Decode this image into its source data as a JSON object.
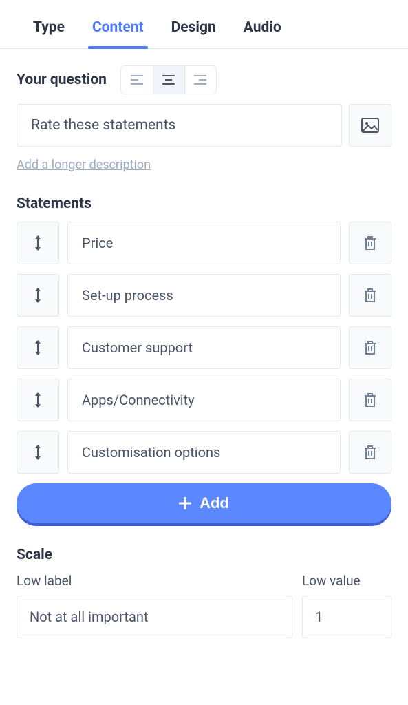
{
  "tabs": [
    {
      "label": "Type",
      "active": false
    },
    {
      "label": "Content",
      "active": true
    },
    {
      "label": "Design",
      "active": false
    },
    {
      "label": "Audio",
      "active": false
    }
  ],
  "question": {
    "label": "Your question",
    "value": "Rate these statements",
    "add_description": "Add a longer description",
    "alignment": "center"
  },
  "statements": {
    "label": "Statements",
    "items": [
      {
        "value": "Price"
      },
      {
        "value": "Set-up process"
      },
      {
        "value": "Customer support"
      },
      {
        "value": "Apps/Connectivity"
      },
      {
        "value": "Customisation options"
      }
    ],
    "add_label": "Add"
  },
  "scale": {
    "label": "Scale",
    "low_label_caption": "Low label",
    "low_label_value": "Not at all important",
    "low_value_caption": "Low value",
    "low_value": "1"
  },
  "icons": {
    "align_left": "align-left-icon",
    "align_center": "align-center-icon",
    "align_right": "align-right-icon",
    "image": "image-icon",
    "drag": "drag-handle-icon",
    "trash": "trash-icon",
    "plus": "plus-icon"
  }
}
